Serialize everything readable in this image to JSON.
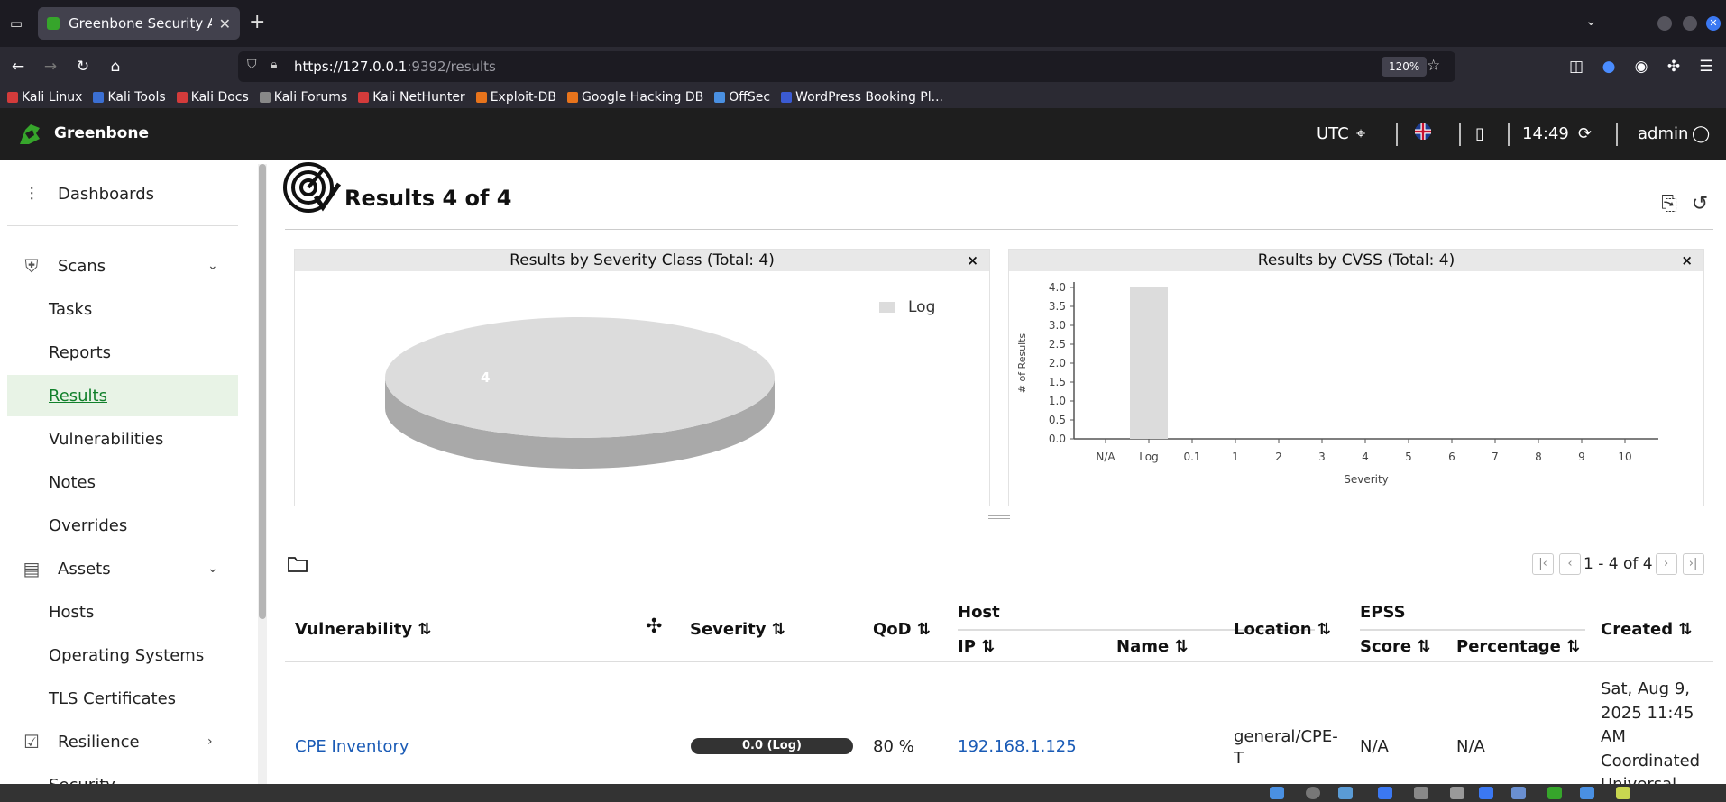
{
  "browser": {
    "tab_title": "Greenbone Security Assis",
    "url_host": "https://127.0.0.1",
    "url_path": ":9392/results",
    "zoom": "120%",
    "bookmarks": [
      "Kali Linux",
      "Kali Tools",
      "Kali Docs",
      "Kali Forums",
      "Kali NetHunter",
      "Exploit-DB",
      "Google Hacking DB",
      "OffSec",
      "WordPress Booking Pl..."
    ],
    "bookmark_colors": [
      "#d33b3b",
      "#3b6fd3",
      "#d33b3b",
      "#888888",
      "#d33b3b",
      "#e8741c",
      "#e8741c",
      "#4a90e2",
      "#3b5bd3"
    ]
  },
  "header": {
    "brand": "Greenbone",
    "timezone": "UTC",
    "time": "14:49",
    "user": "admin"
  },
  "sidebar": {
    "dashboards": "Dashboards",
    "scans": "Scans",
    "scan_items": [
      "Tasks",
      "Reports",
      "Results",
      "Vulnerabilities",
      "Notes",
      "Overrides"
    ],
    "assets": "Assets",
    "asset_items": [
      "Hosts",
      "Operating Systems",
      "TLS Certificates"
    ],
    "resilience": "Resilience",
    "partial_item": "Security"
  },
  "page": {
    "title": "Results 4 of 4"
  },
  "charts": {
    "severity_title": "Results by Severity Class (Total: 4)",
    "cvss_title": "Results by CVSS (Total: 4)",
    "close_glyph": "×"
  },
  "chart_data": [
    {
      "type": "pie",
      "title": "Results by Severity Class (Total: 4)",
      "categories": [
        "Log"
      ],
      "values": [
        4
      ],
      "legend": [
        "Log"
      ],
      "legend_position": "top-right",
      "colors": [
        "#dcdcdc"
      ]
    },
    {
      "type": "bar",
      "title": "Results by CVSS (Total: 4)",
      "categories": [
        "N/A",
        "Log",
        "0.1",
        "1",
        "2",
        "3",
        "4",
        "5",
        "6",
        "7",
        "8",
        "9",
        "10"
      ],
      "values": [
        0,
        4,
        0,
        0,
        0,
        0,
        0,
        0,
        0,
        0,
        0,
        0,
        0
      ],
      "xlabel": "Severity",
      "ylabel": "# of Results",
      "ylim": [
        0,
        4
      ],
      "yticks": [
        "0.0",
        "0.5",
        "1.0",
        "1.5",
        "2.0",
        "2.5",
        "3.0",
        "3.5",
        "4.0"
      ],
      "colors": [
        "#dcdcdc"
      ]
    }
  ],
  "pager": {
    "text": "1 - 4 of 4"
  },
  "table": {
    "col_vulnerability": "Vulnerability ⇅",
    "col_severity": "Severity ⇅",
    "col_qod": "QoD ⇅",
    "col_host": "Host",
    "col_ip": "IP ⇅",
    "col_name": "Name ⇅",
    "col_location": "Location ⇅",
    "col_epss": "EPSS",
    "col_score": "Score ⇅",
    "col_percentage": "Percentage ⇅",
    "col_created": "Created ⇅",
    "row": {
      "vulnerability": "CPE Inventory",
      "severity": "0.0 (Log)",
      "qod": "80 %",
      "ip": "192.168.1.125",
      "location_1": "general/CPE-",
      "location_2": "T",
      "score": "N/A",
      "percentage": "N/A",
      "created_1": "Sat, Aug 9,",
      "created_2": "2025 11:45",
      "created_3": "AM",
      "created_4": "Coordinated",
      "created_5": "Universal"
    }
  }
}
